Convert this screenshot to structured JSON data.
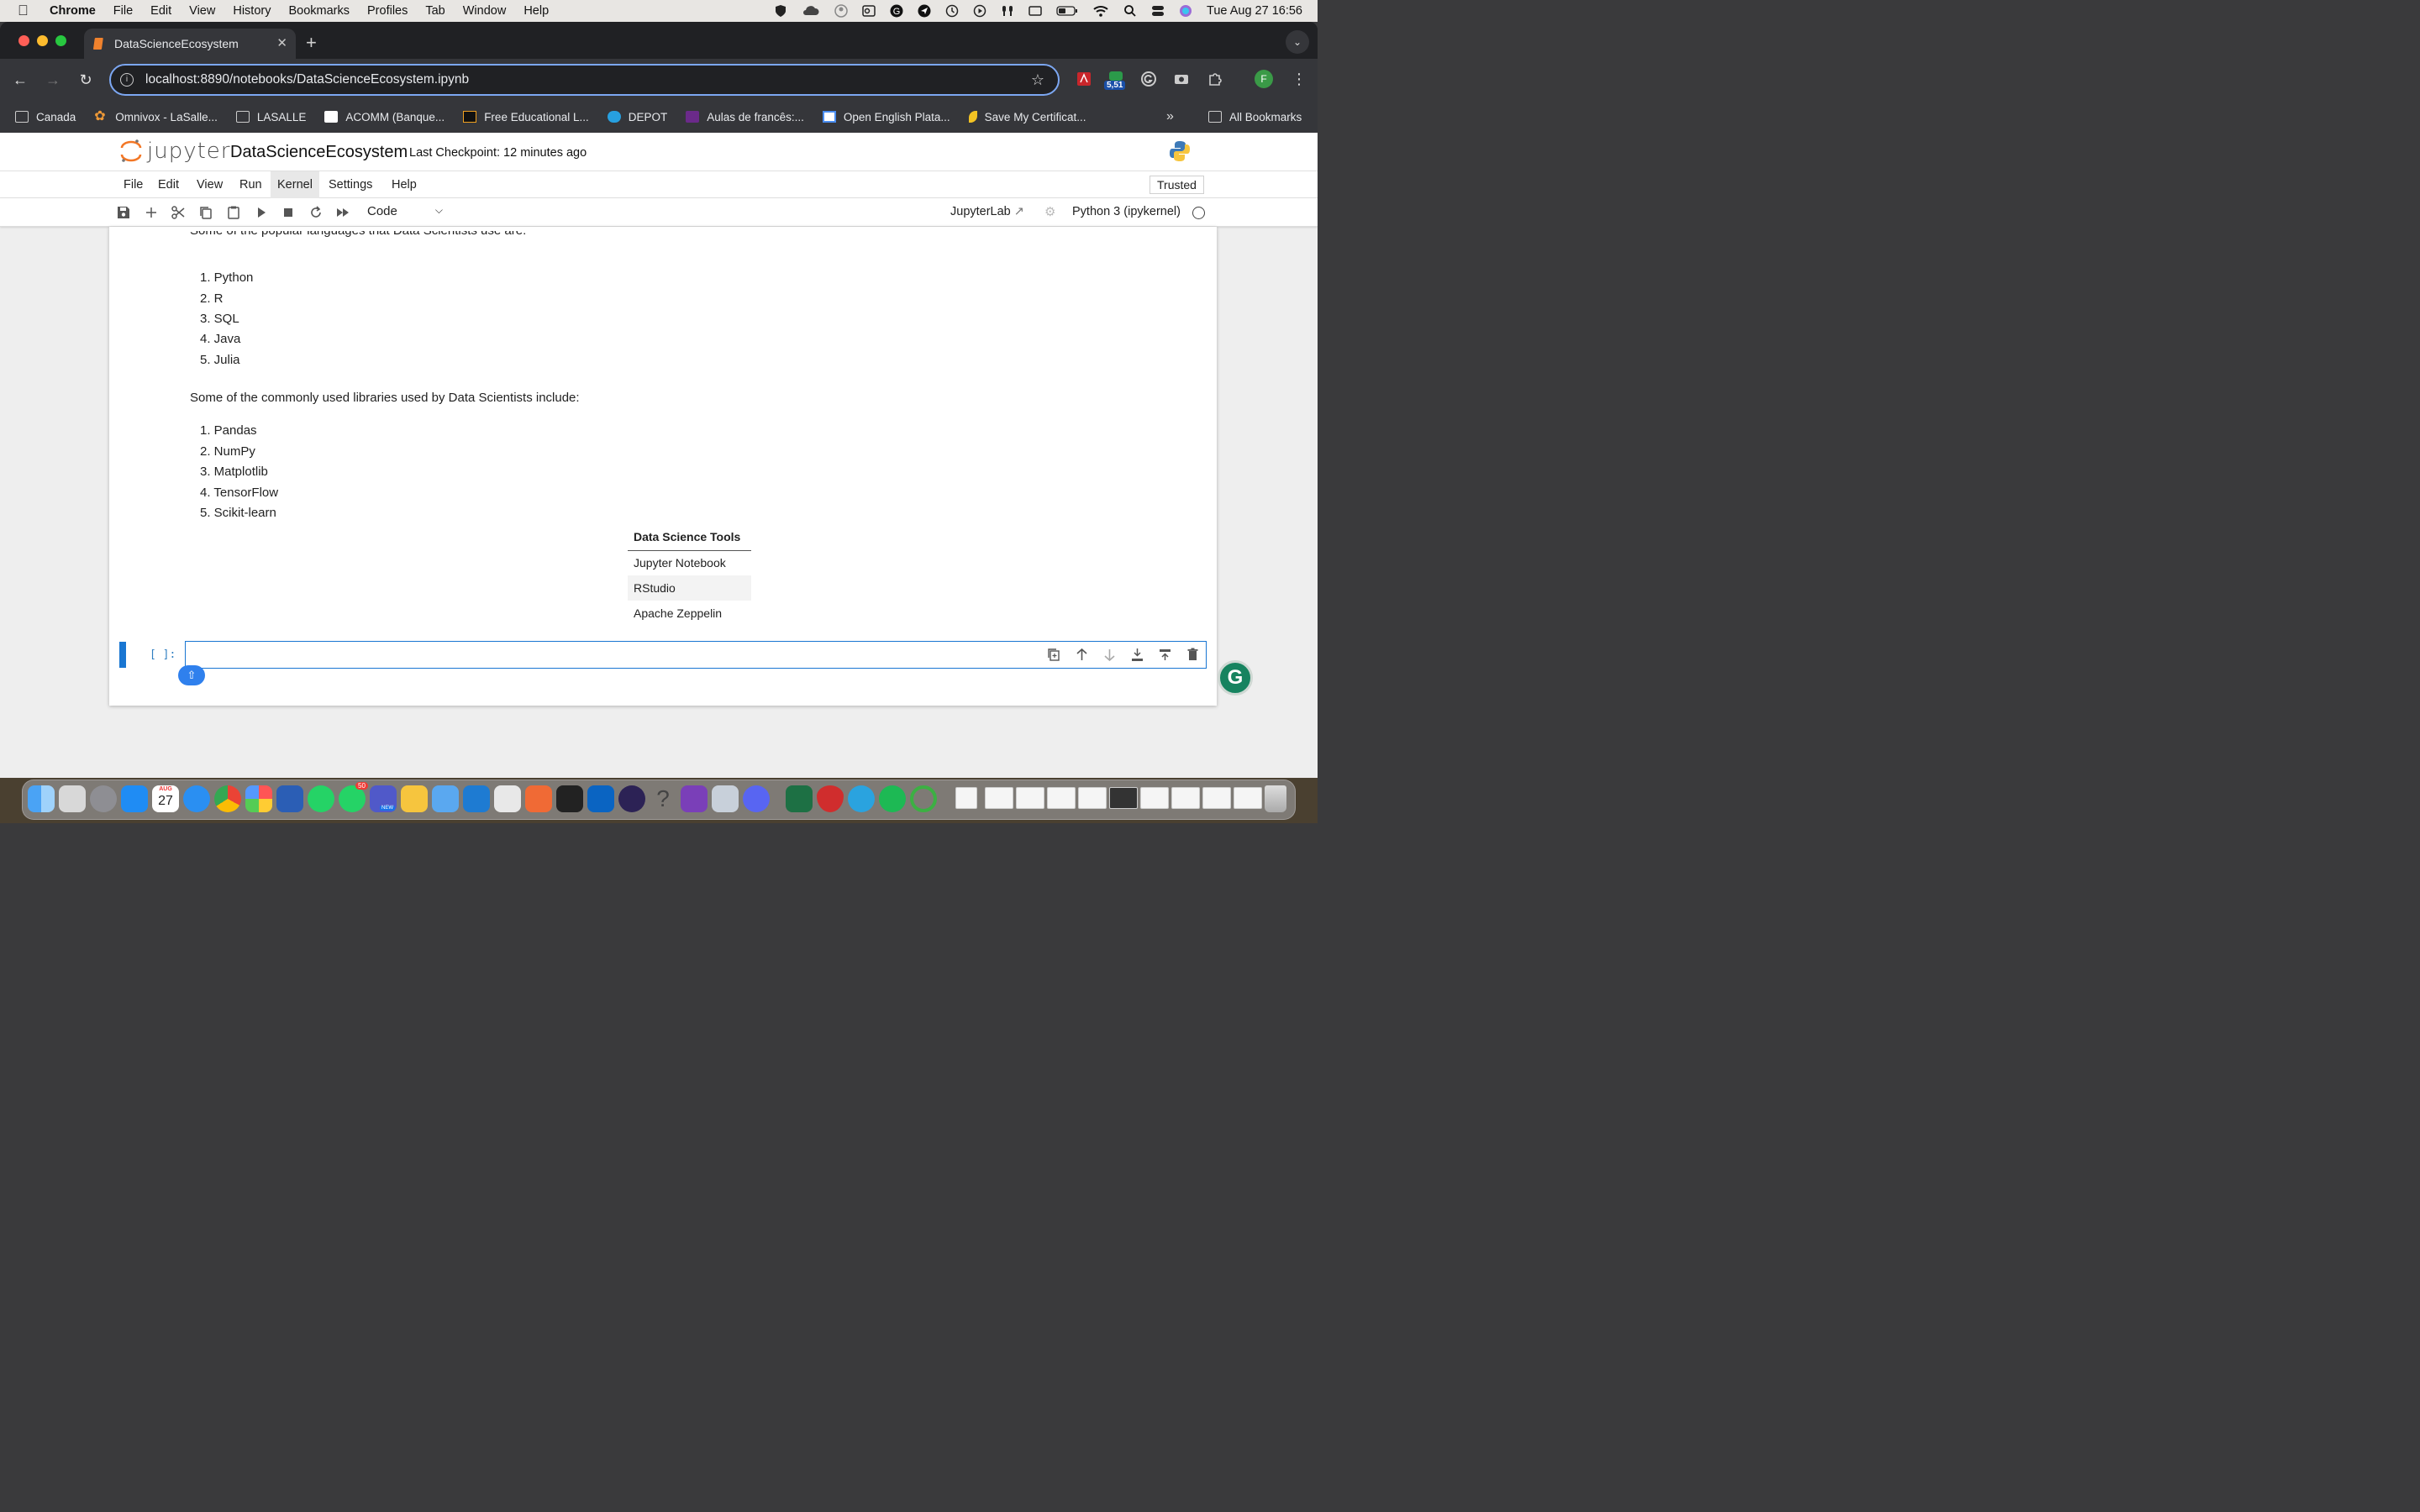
{
  "menubar": {
    "app": "Chrome",
    "items": [
      "File",
      "Edit",
      "View",
      "History",
      "Bookmarks",
      "Profiles",
      "Tab",
      "Window",
      "Help"
    ],
    "clock": "Tue Aug 27  16:56"
  },
  "browser": {
    "tab_title": "DataScienceEcosystem",
    "url": "localhost:8890/notebooks/DataScienceEcosystem.ipynb",
    "extension_badge": "5,51",
    "profile_initial": "F",
    "bookmarks": [
      "Canada",
      "Omnivox - LaSalle...",
      "LASALLE",
      "ACOMM (Banque...",
      "Free Educational L...",
      "DEPOT",
      "Aulas de francês:...",
      "Open English Plata...",
      "Save My Certificat..."
    ],
    "all_bookmarks": "All Bookmarks",
    "colors": {
      "accent": "#7ca7f2",
      "frame": "#202124",
      "toolbar": "#35363a"
    }
  },
  "jupyter": {
    "logo_text": "jupyter",
    "notebook_title": "DataScienceEcosystem",
    "checkpoint": "Last Checkpoint: 12 minutes ago",
    "menu": [
      "File",
      "Edit",
      "View",
      "Run",
      "Kernel",
      "Settings",
      "Help"
    ],
    "trusted": "Trusted",
    "cell_type": "Code",
    "jupyterlab_link": "JupyterLab",
    "kernel": "Python 3 (ipykernel)"
  },
  "notebook": {
    "languages_intro": "Some of the popular languages that Data Scientists use are:",
    "languages": [
      "1. Python",
      "2. R",
      "3. SQL",
      "4. Java",
      "5. Julia"
    ],
    "libraries_intro": "Some of the commonly used libraries used by Data Scientists include:",
    "libraries": [
      "1. Pandas",
      "2. NumPy",
      "3. Matplotlib",
      "4. TensorFlow",
      "5. Scikit-learn"
    ],
    "table": {
      "header": "Data Science Tools",
      "rows": [
        "Jupyter Notebook",
        "RStudio",
        "Apache Zeppelin"
      ]
    },
    "prompt": "[ ]:"
  },
  "dock": {
    "calendar_month": "AUG",
    "calendar_day": "27",
    "teams_badge": "50",
    "teams_tag": "NEW"
  },
  "icons": [
    "apple-icon",
    "search-icon",
    "wifi-icon",
    "star-icon",
    "save-icon",
    "cut-icon",
    "copy-icon",
    "paste-icon",
    "run-icon",
    "stop-icon",
    "restart-icon",
    "fast-forward-icon",
    "duplicate-icon",
    "move-up-icon",
    "move-down-icon",
    "insert-below-icon",
    "insert-above-icon",
    "trash-icon"
  ]
}
